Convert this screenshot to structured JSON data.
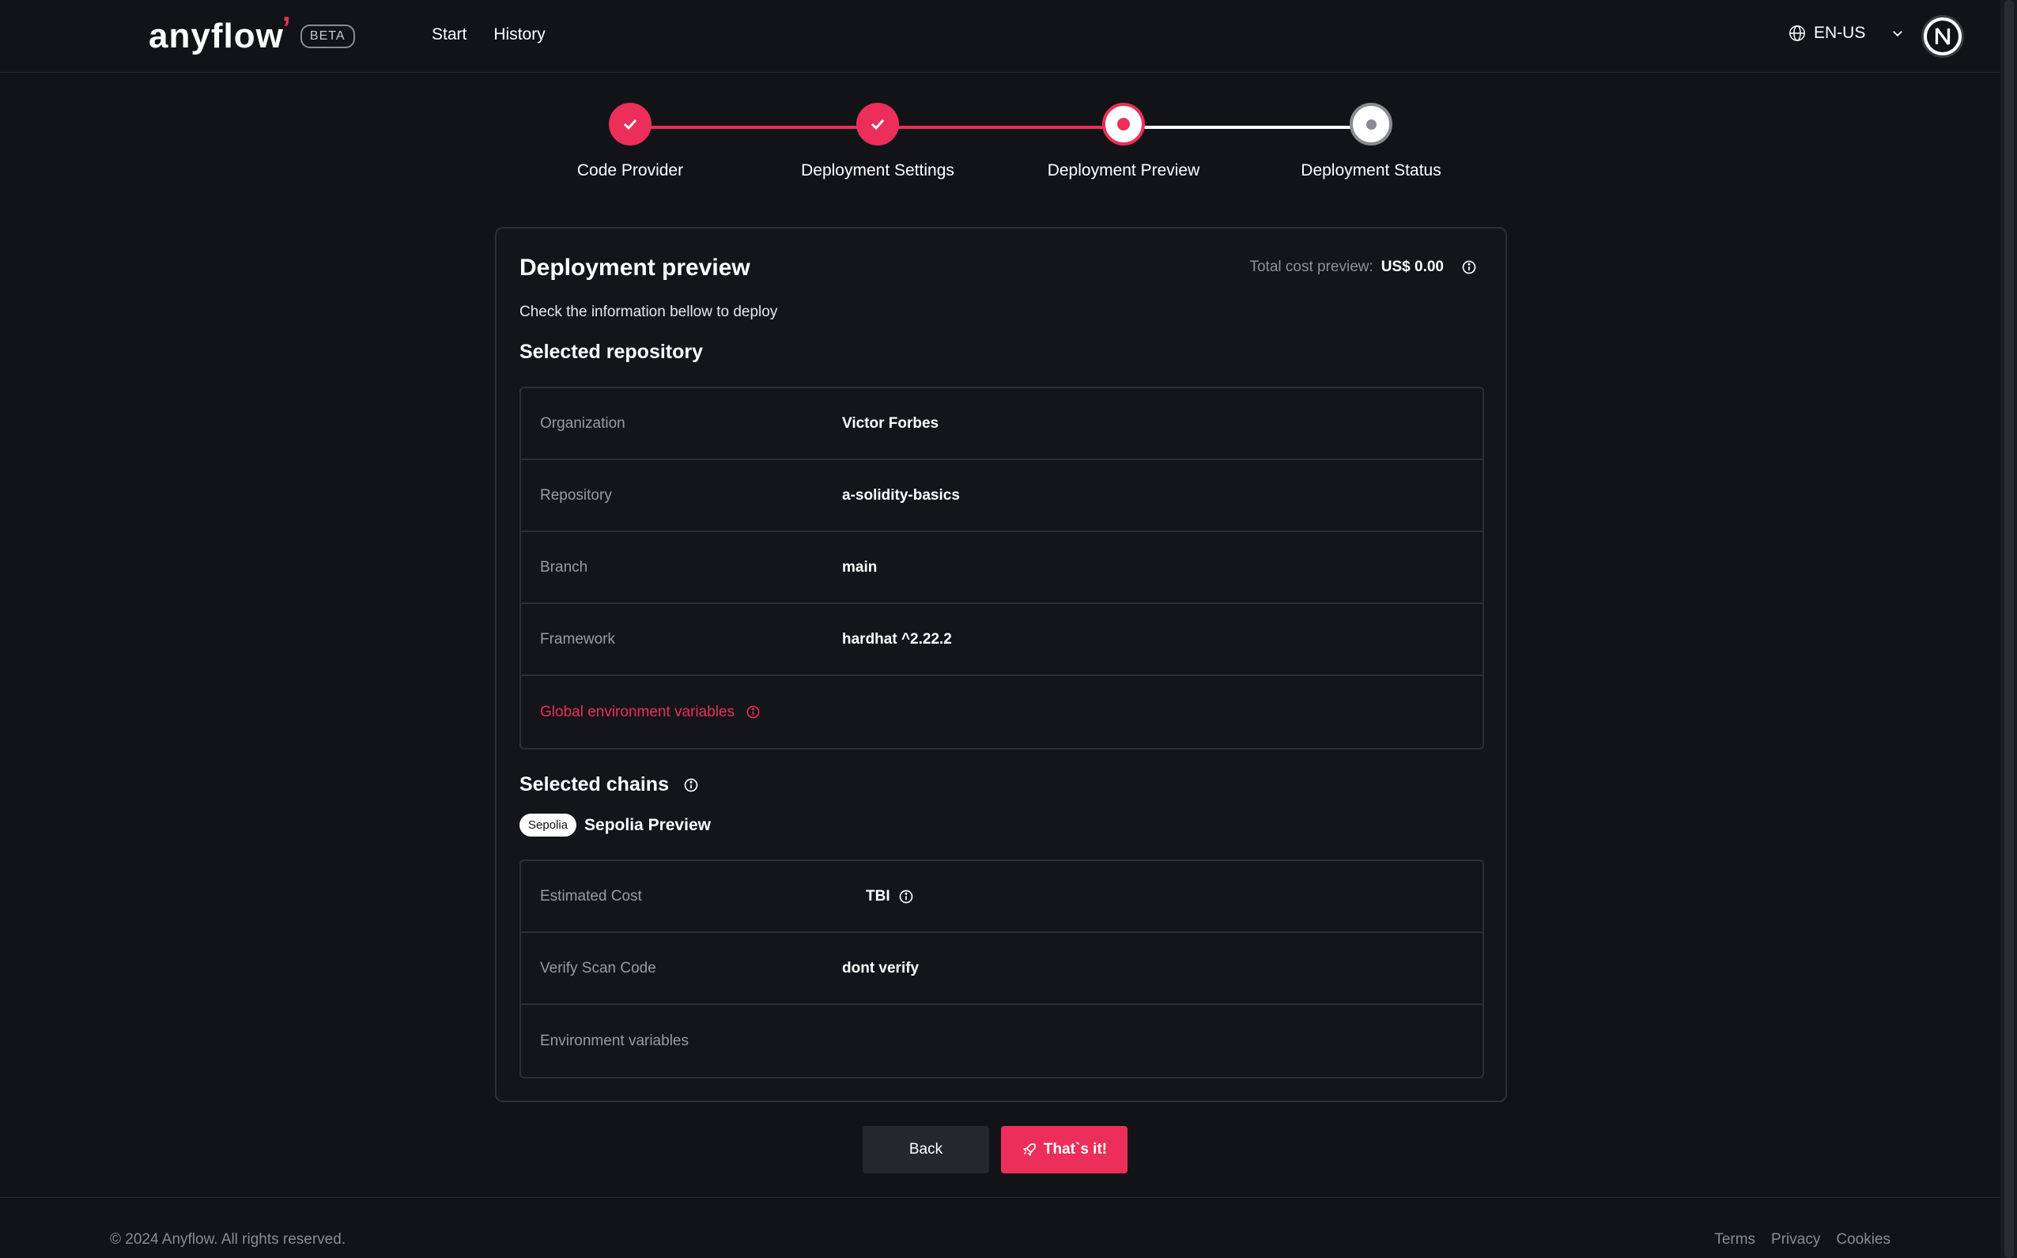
{
  "header": {
    "logo": "anyflow",
    "beta": "BETA",
    "nav": [
      "Start",
      "History"
    ],
    "language": "EN-US"
  },
  "stepper": {
    "steps": [
      {
        "label": "Code Provider",
        "state": "done"
      },
      {
        "label": "Deployment Settings",
        "state": "done"
      },
      {
        "label": "Deployment Preview",
        "state": "current"
      },
      {
        "label": "Deployment Status",
        "state": "todo"
      }
    ]
  },
  "card": {
    "title": "Deployment preview",
    "subtitle": "Check the information bellow to deploy",
    "cost_label": "Total cost preview:",
    "cost_value": "US$ 0.00",
    "repo_section": "Selected repository",
    "repo_rows": [
      {
        "label": "Organization",
        "value": "Victor Forbes"
      },
      {
        "label": "Repository",
        "value": "a-solidity-basics"
      },
      {
        "label": "Branch",
        "value": "main"
      },
      {
        "label": "Framework",
        "value": "hardhat ^2.22.2"
      },
      {
        "label": "Global environment variables",
        "value": ""
      }
    ],
    "chains_section": "Selected chains",
    "chain_pill": "Sepolia",
    "chain_name": "Sepolia Preview",
    "chain_rows": [
      {
        "label": "Estimated Cost",
        "value": "TBI"
      },
      {
        "label": "Verify Scan Code",
        "value": "dont verify"
      },
      {
        "label": "Environment variables",
        "value": ""
      }
    ]
  },
  "buttons": {
    "back": "Back",
    "confirm": "That`s it!"
  },
  "footer": {
    "copyright": "© 2024 Anyflow. All rights reserved.",
    "links": [
      "Terms",
      "Privacy",
      "Cookies"
    ]
  },
  "colors": {
    "accent": "#ec2e5a",
    "background": "#121317"
  }
}
